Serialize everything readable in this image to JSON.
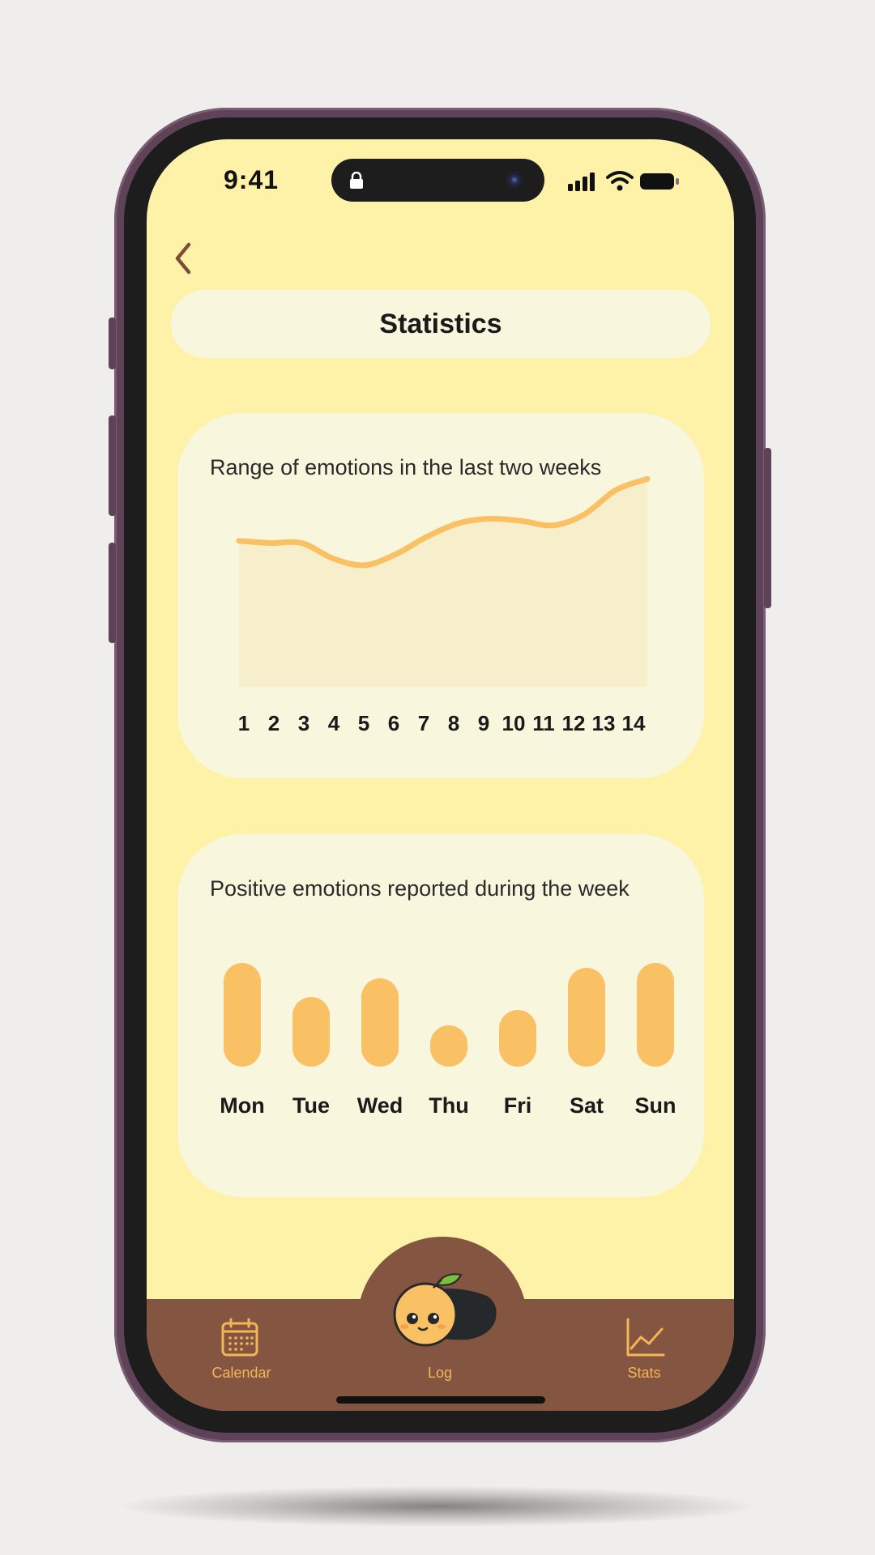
{
  "status_bar": {
    "time": "9:41",
    "icons": [
      "lock-icon",
      "camera-icon",
      "signal-icon",
      "wifi-icon",
      "battery-icon"
    ]
  },
  "header": {
    "back_icon": "chevron-left-icon",
    "title": "Statistics"
  },
  "colors": {
    "background": "#fdf2a8",
    "card": "#f8f6dc",
    "accent": "#f9c064",
    "nav": "#845641",
    "nav_label": "#f4b557"
  },
  "line_card": {
    "title": "Range of emotions in the last two weeks",
    "chart_data": {
      "type": "area",
      "title": "Range of emotions in the last two weeks",
      "x": [
        1,
        2,
        3,
        4,
        5,
        6,
        7,
        8,
        9,
        10,
        11,
        12,
        13,
        14
      ],
      "values": [
        66,
        65,
        65,
        58,
        55,
        60,
        68,
        74,
        76,
        75,
        73,
        78,
        89,
        94
      ],
      "ylim": [
        0,
        100
      ],
      "grid": false,
      "x_tick_labels": [
        "1",
        "2",
        "3",
        "4",
        "5",
        "6",
        "7",
        "8",
        "9",
        "10",
        "11",
        "12",
        "13",
        "14"
      ]
    }
  },
  "bar_card": {
    "title": "Positive emotions reported during the week",
    "chart_data": {
      "type": "bar",
      "title": "Positive emotions reported during the week",
      "categories": [
        "Mon",
        "Tue",
        "Wed",
        "Thu",
        "Fri",
        "Sat",
        "Sun"
      ],
      "values": [
        100,
        67,
        85,
        40,
        55,
        95,
        100
      ],
      "ylim": [
        0,
        100
      ],
      "grid": false
    }
  },
  "bottom_nav": {
    "items": [
      {
        "label": "Calendar",
        "icon": "calendar-icon"
      },
      {
        "label": "Log",
        "icon": "mascot-icon"
      },
      {
        "label": "Stats",
        "icon": "chart-icon"
      }
    ]
  }
}
